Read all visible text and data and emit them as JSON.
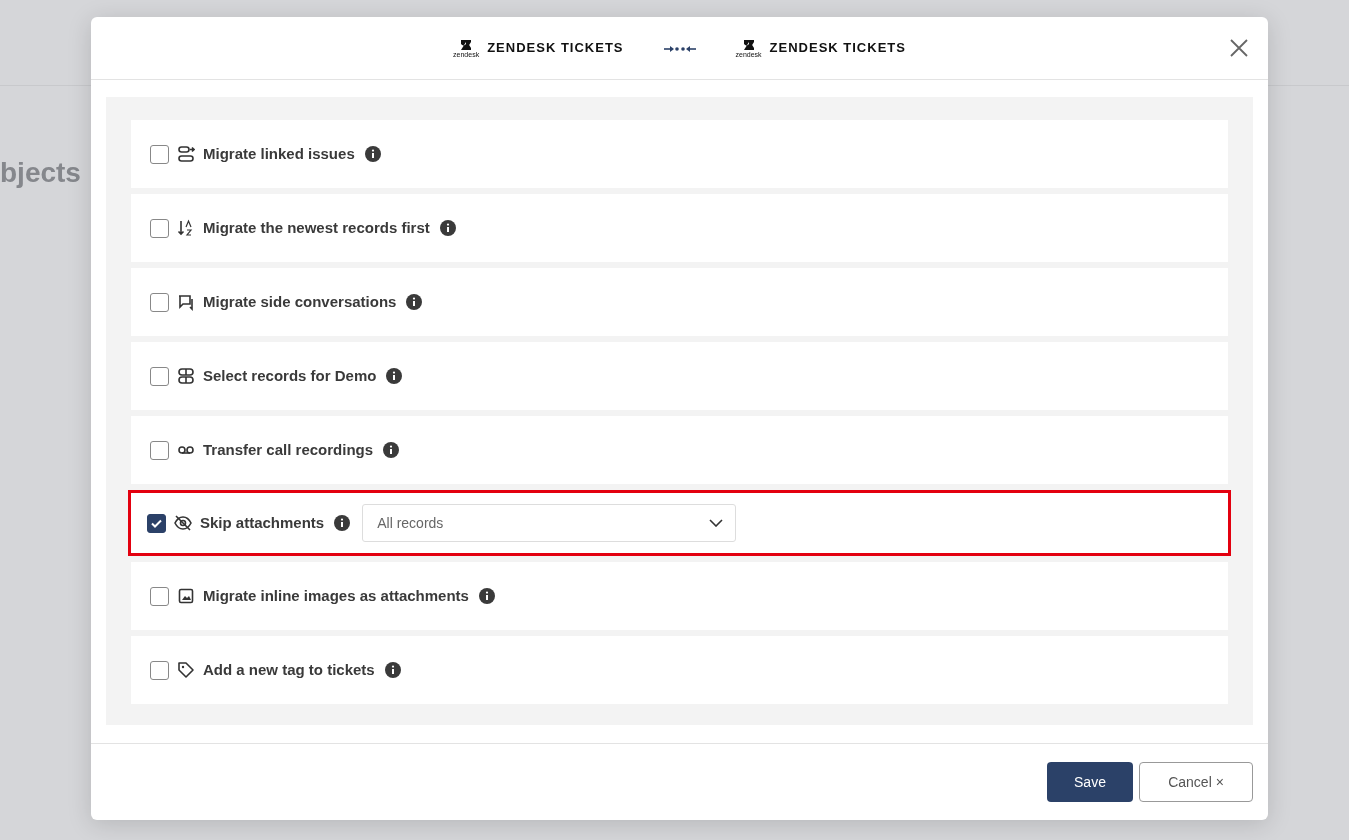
{
  "background": {
    "heading": "bjects"
  },
  "dialog": {
    "header": {
      "source": {
        "brand": "zendesk",
        "title": "ZENDESK TICKETS"
      },
      "target": {
        "brand": "zendesk",
        "title": "ZENDESK TICKETS"
      }
    },
    "options": [
      {
        "kind": "checkbox",
        "label": "Migrate linked issues",
        "checked": false,
        "highlighted": false
      },
      {
        "kind": "checkbox",
        "label": "Migrate the newest records first",
        "checked": false,
        "highlighted": false
      },
      {
        "kind": "checkbox",
        "label": "Migrate side conversations",
        "checked": false,
        "highlighted": false
      },
      {
        "kind": "checkbox",
        "label": "Select records for Demo",
        "checked": false,
        "highlighted": false
      },
      {
        "kind": "checkbox",
        "label": "Transfer call recordings",
        "checked": false,
        "highlighted": false
      },
      {
        "kind": "select",
        "label": "Skip attachments",
        "checked": true,
        "highlighted": true,
        "value": "All records"
      },
      {
        "kind": "checkbox",
        "label": "Migrate inline images as attachments",
        "checked": false,
        "highlighted": false
      },
      {
        "kind": "checkbox",
        "label": "Add a new tag to tickets",
        "checked": false,
        "highlighted": false
      }
    ],
    "buttons": [
      {
        "kind": "primary",
        "label": "Save"
      },
      {
        "kind": "secondary",
        "label": "Cancel ×"
      }
    ]
  }
}
